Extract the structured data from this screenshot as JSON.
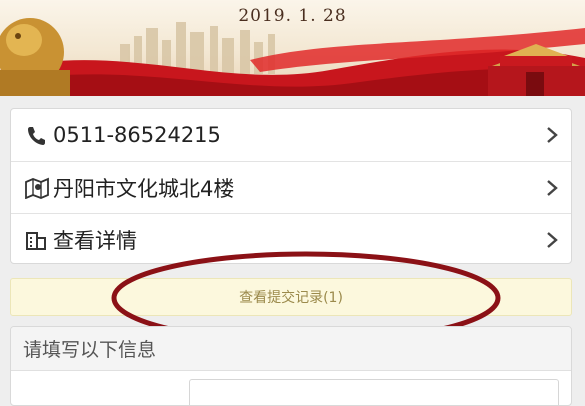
{
  "banner": {
    "date": "2019. 1. 28",
    "theme_colors": {
      "red": "#c8161d",
      "gold": "#d9a441",
      "sky": "#f3e7d2"
    }
  },
  "contact": {
    "phone": "0511-86524215",
    "address": "丹阳市文化城北4楼",
    "details_label": "查看详情"
  },
  "records": {
    "label": "查看提交记录(1)",
    "highlight_color": "#8b1116"
  },
  "form": {
    "section_title": "请填写以下信息",
    "first_field_label": "",
    "first_field_value": ""
  },
  "icons": {
    "phone": "phone-icon",
    "map": "map-pin-icon",
    "details": "building-icon",
    "chevron": "chevron-right-icon"
  }
}
